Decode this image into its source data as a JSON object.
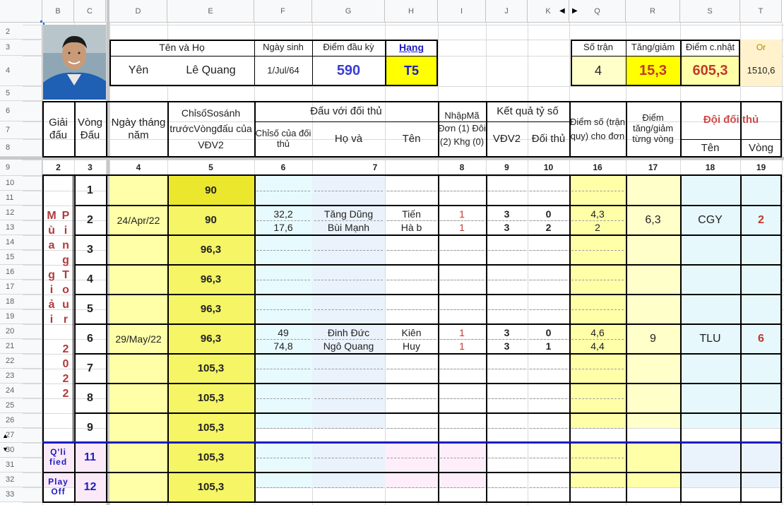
{
  "sheet": {
    "col_headers": [
      "B",
      "C",
      "D",
      "E",
      "F",
      "G",
      "H",
      "I",
      "J",
      "K",
      "Q",
      "R",
      "S",
      "T"
    ],
    "row_headers": [
      "2",
      "3",
      "4",
      "5",
      "6",
      "7",
      "8",
      "9",
      "10",
      "11",
      "12",
      "13",
      "14",
      "15",
      "16",
      "17",
      "18",
      "19",
      "20",
      "21",
      "22",
      "23",
      "24",
      "25",
      "26",
      "27",
      "30",
      "31",
      "32",
      "33"
    ]
  },
  "profile": {
    "name_label": "Tên     và   Họ",
    "first_name": "Yên",
    "last_name": "Lê Quang",
    "birth_label": "Ngày sinh",
    "birth_value": "1/Jul/64",
    "start_points_label": "Điểm đầu kỳ",
    "start_points_value": "590",
    "rank_label": "Hạng",
    "rank_value": "T5"
  },
  "summary": {
    "matches_label": "Số trận",
    "matches_value": "4",
    "change_label": "Tăng/giảm",
    "change_value": "15,3",
    "updated_label": "Điểm c.nhật",
    "updated_value": "605,3",
    "or_label": "Or",
    "or_value": "1510,6"
  },
  "table_header": {
    "tournament": "Giải đấu",
    "round": "Vòng Đấu",
    "date": "Ngày tháng năm",
    "index_before": "ChỉsốSosánh trướcVòngđấu của VĐV2",
    "vs_opponent": "Đấu với đối thủ",
    "opp_index": "Chỉsố của đối thủ",
    "opp_surname": "Họ     và",
    "opp_name": "Tên",
    "entry_code": "NhậpMã Đơn (1) Đôi (2) Khg (0)",
    "result": "Kết quả tỷ số",
    "vdv2": "VĐV2",
    "opp": "Đối thủ",
    "points": "Điểm số (trận quy) cho đơn",
    "change_per_round": "Điểm tăng/giảm từng vòng",
    "opp_team": "Đội đối thủ",
    "team_name": "Tên",
    "team_round": "Vòng",
    "numbers": [
      "2",
      "3",
      "4",
      "5",
      "6",
      "7",
      "8",
      "9",
      "10",
      "16",
      "17",
      "18",
      "19"
    ]
  },
  "tournament_vertical_1": [
    "M",
    "ù",
    "a",
    "",
    "g",
    "i",
    "ả",
    "i"
  ],
  "tournament_vertical_2": [
    "P",
    "i",
    "n",
    "g",
    "T",
    "o",
    "u",
    "r",
    "",
    "2",
    "0",
    "2",
    "2"
  ],
  "rounds": [
    {
      "round": "1",
      "date": "",
      "index": "90"
    },
    {
      "round": "2",
      "date": "24/Apr/22",
      "index": "90",
      "matches": [
        {
          "opp_index": "32,2",
          "surname": "Tăng Dũng",
          "name": "Tiến",
          "code": "1",
          "vdv2": "3",
          "opp": "0",
          "points": "4,3"
        },
        {
          "opp_index": "17,6",
          "surname": "Bùi Mạnh",
          "name": "Hà b",
          "code": "1",
          "vdv2": "3",
          "opp": "2",
          "points": "2"
        }
      ],
      "change": "6,3",
      "team": "CGY",
      "team_round": "2"
    },
    {
      "round": "3",
      "date": "",
      "index": "96,3"
    },
    {
      "round": "4",
      "date": "",
      "index": "96,3"
    },
    {
      "round": "5",
      "date": "",
      "index": "96,3"
    },
    {
      "round": "6",
      "date": "29/May/22",
      "index": "96,3",
      "matches": [
        {
          "opp_index": "49",
          "surname": "Đinh Đức",
          "name": "Kiên",
          "code": "1",
          "vdv2": "3",
          "opp": "0",
          "points": "4,6"
        },
        {
          "opp_index": "74,8",
          "surname": "Ngô Quang",
          "name": "Huy",
          "code": "1",
          "vdv2": "3",
          "opp": "1",
          "points": "4,4"
        }
      ],
      "change": "9",
      "team": "TLU",
      "team_round": "6"
    },
    {
      "round": "7",
      "date": "",
      "index": "105,3"
    },
    {
      "round": "8",
      "date": "",
      "index": "105,3"
    },
    {
      "round": "9",
      "date": "",
      "index": "105,3"
    }
  ],
  "extra_rounds": [
    {
      "label": "Q'li fied",
      "round": "11",
      "index": "105,3"
    },
    {
      "label": "Play Off",
      "round": "12",
      "index": "105,3"
    }
  ]
}
